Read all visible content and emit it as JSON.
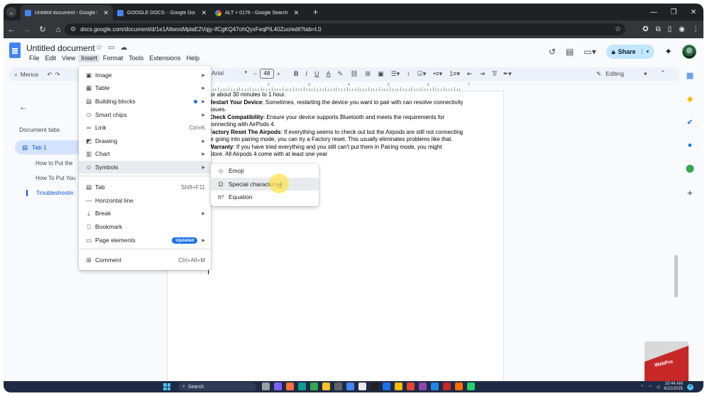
{
  "browser": {
    "tabs": [
      {
        "title": "Untitled document - Google Docs",
        "active": true
      },
      {
        "title": "GOOGLE DOCS: - Google Docs",
        "active": false
      },
      {
        "title": "ALT + 0176 - Google Search",
        "active": false
      }
    ],
    "url": "docs.google.com/document/d/1e1AltwosMplaE2Vqjy-ifCgKQ47ohQyxFeqPIL40Zuo/edit?tab=t.0"
  },
  "docs": {
    "title": "Untitled document",
    "menu": [
      "File",
      "Edit",
      "View",
      "Insert",
      "Format",
      "Tools",
      "Extensions",
      "Help"
    ],
    "share_label": "Share",
    "toolbar": {
      "menus_label": "Menus",
      "font": "Arial",
      "font_size": "48",
      "editing_label": "Editing"
    }
  },
  "left_panel": {
    "heading": "Document tabs",
    "tab": "Tab 1",
    "outline": [
      "How to Put the",
      "How To Put You",
      "Troubleshootin"
    ]
  },
  "ruler_numbers": [
    "1",
    "2",
    "3",
    "4",
    "5",
    "6",
    "7"
  ],
  "document": {
    "lines": [
      {
        "bold": "",
        "text": "for about 30 minutes to 1 hour."
      },
      {
        "bold": "Restart Your Device",
        "text": ": Sometimes, restarting the device you want to pair with can resolve connectivity issues."
      },
      {
        "bold": "Check Compatibility",
        "text": ": Ensure your device supports Bluetooth and meets the requirements for connecting with AirPods 4."
      },
      {
        "bold": "Factory Reset The Airpods",
        "text": ": If everything seems to check out but the Airpods are still not connecting or going into pairing mode, you can try a Factory reset. This usually eliminates problems like that."
      },
      {
        "bold": "Warranty",
        "text": ": If you have tried everything and you still can't put them in Pairing mode, you might                                          Store. All Airpods 4 come with at least one year"
      }
    ]
  },
  "insert_menu": {
    "items": [
      {
        "icon": "image-icon",
        "label": "Image",
        "shortcut": "",
        "submenu": true
      },
      {
        "icon": "table-icon",
        "label": "Table",
        "shortcut": "",
        "submenu": true
      },
      {
        "icon": "building-blocks-icon",
        "label": "Building blocks",
        "shortcut": "",
        "submenu": true,
        "dot": true
      },
      {
        "icon": "smart-chips-icon",
        "label": "Smart chips",
        "shortcut": "",
        "submenu": true
      },
      {
        "icon": "link-icon",
        "label": "Link",
        "shortcut": "Ctrl+K",
        "submenu": false
      },
      {
        "icon": "drawing-icon",
        "label": "Drawing",
        "shortcut": "",
        "submenu": true
      },
      {
        "icon": "chart-icon",
        "label": "Chart",
        "shortcut": "",
        "submenu": true
      },
      {
        "icon": "symbols-icon",
        "label": "Symbols",
        "shortcut": "",
        "submenu": true,
        "hover": true
      },
      {
        "icon": "tab-icon",
        "label": "Tab",
        "shortcut": "Shift+F11",
        "submenu": false
      },
      {
        "icon": "horizontal-line-icon",
        "label": "Horizontal line",
        "shortcut": "",
        "submenu": false
      },
      {
        "icon": "break-icon",
        "label": "Break",
        "shortcut": "",
        "submenu": true
      },
      {
        "icon": "bookmark-icon",
        "label": "Bookmark",
        "shortcut": "",
        "submenu": false
      },
      {
        "icon": "page-elements-icon",
        "label": "Page elements",
        "shortcut": "",
        "submenu": true,
        "badge": "Updated"
      },
      {
        "icon": "comment-icon",
        "label": "Comment",
        "shortcut": "Ctrl+Alt+M",
        "submenu": false
      }
    ]
  },
  "symbols_submenu": {
    "items": [
      {
        "icon": "emoji-icon",
        "label": "Emoji"
      },
      {
        "icon": "omega-icon",
        "label": "Special characters",
        "hover": true
      },
      {
        "icon": "equation-icon",
        "label": "Equation"
      }
    ]
  },
  "taskbar": {
    "search_label": "Search",
    "time": "10:44 AM",
    "date": "6/22/2025",
    "notifications": "4"
  },
  "watermark": "WebPro"
}
